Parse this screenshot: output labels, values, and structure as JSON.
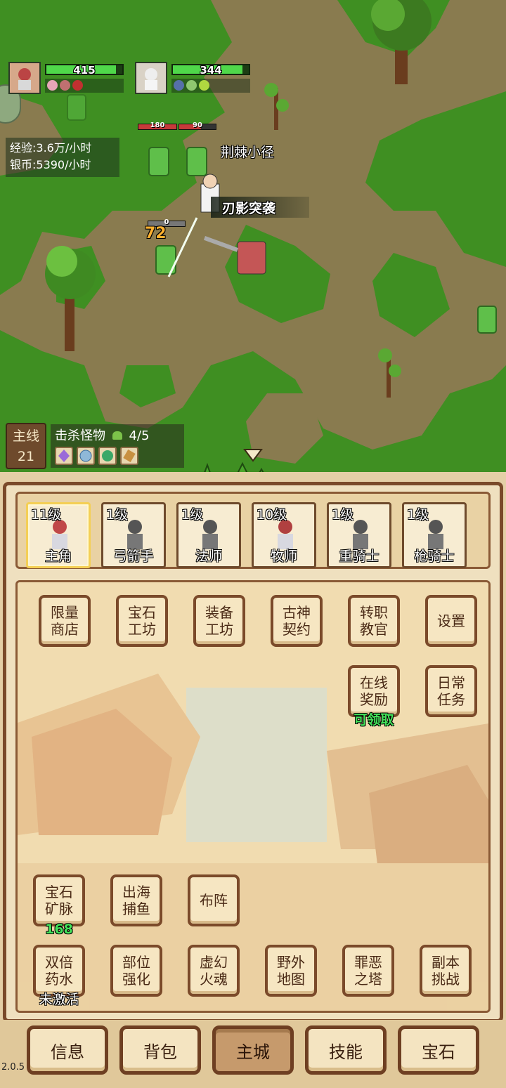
{
  "party": [
    {
      "hp": "415",
      "hp_fraction": 0.92,
      "selected": true,
      "buffs": [
        "#e7a6b8",
        "#c07070",
        "#c03030"
      ]
    },
    {
      "hp": "344",
      "hp_fraction": 0.92,
      "selected": false,
      "buffs": [
        "#5670a8",
        "#8fc870",
        "#b0d840"
      ]
    }
  ],
  "stats": {
    "exp_rate": "经验:3.6万/小时",
    "silver_rate": "银币:5390/小时"
  },
  "battle": {
    "location": "荆棘小径",
    "skill": "刃影突袭",
    "damage": "72",
    "enemy_bar_left": "180",
    "enemy_bar_right": "90",
    "target_bar": "0"
  },
  "quest": {
    "tag_line1": "主线",
    "tag_line2": "21",
    "title": "击杀怪物",
    "progress": "4/5",
    "rewards": [
      "reward-crystal-icon",
      "reward-orb-icon",
      "reward-gem-icon",
      "reward-scroll-icon"
    ]
  },
  "heroes": [
    {
      "level": "11级",
      "name": "主角",
      "selected": true,
      "color": "#c04848"
    },
    {
      "level": "1级",
      "name": "弓箭手",
      "selected": false,
      "color": "#555555"
    },
    {
      "level": "1级",
      "name": "法师",
      "selected": false,
      "color": "#555555"
    },
    {
      "level": "10级",
      "name": "牧师",
      "selected": false,
      "color": "#b04040"
    },
    {
      "level": "1级",
      "name": "重骑士",
      "selected": false,
      "color": "#555555"
    },
    {
      "level": "1级",
      "name": "枪骑士",
      "selected": false,
      "color": "#555555"
    }
  ],
  "features": {
    "limited_shop": "限量\n商店",
    "gem_workshop": "宝石\n工坊",
    "equip_workshop": "装备\n工坊",
    "ancient_contract": "古神\n契约",
    "job_mentor": "转职\n教官",
    "settings": "设置",
    "online_reward": "在线\n奖励",
    "online_reward_note": "可领取",
    "daily_task": "日常\n任务",
    "gem_mine": "宝石\n矿脉",
    "gem_mine_note": "168",
    "fishing": "出海\n捕鱼",
    "formation": "布阵",
    "double_potion": "双倍\n药水",
    "double_potion_note": "未激活",
    "part_enhance": "部位\n强化",
    "phantom_soul": "虚幻\n火魂",
    "field_map": "野外\n地图",
    "sin_tower": "罪恶\n之塔",
    "dungeon": "副本\n挑战"
  },
  "colors": {
    "note_green": "#43e25a",
    "note_white": "#ffffff"
  },
  "nav": [
    {
      "label": "信息",
      "active": false
    },
    {
      "label": "背包",
      "active": false
    },
    {
      "label": "主城",
      "active": true
    },
    {
      "label": "技能",
      "active": false
    },
    {
      "label": "宝石",
      "active": false
    }
  ],
  "version": "2.0.5"
}
